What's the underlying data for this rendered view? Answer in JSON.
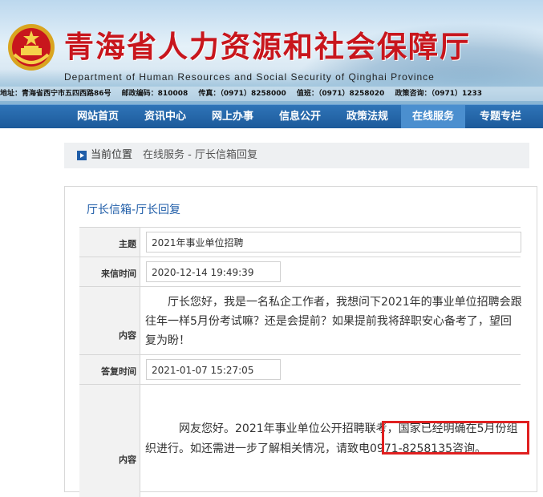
{
  "header": {
    "title": "青海省人力资源和社会保障厅",
    "subtitle": "Department of Human Resources and Social Security of Qinghai Province",
    "info": [
      "地址：青海省西宁市五四西路86号",
      "邮政编码：810008",
      "传真：（0971）8258000",
      "值班：（0971）8258020",
      "政策咨询：（0971）1233"
    ]
  },
  "nav": {
    "items": [
      "网站首页",
      "资讯中心",
      "网上办事",
      "信息公开",
      "政策法规",
      "在线服务",
      "专题专栏"
    ],
    "active_index": 5
  },
  "breadcrumb": {
    "label": "当前位置",
    "path": "在线服务 - 厅长信箱回复"
  },
  "panel": {
    "title": "厅长信箱-厅长回复",
    "subject_label": "主题",
    "subject_value": "2021年事业单位招聘",
    "sent_label": "来信时间",
    "sent_value": "2020-12-14 19:49:39",
    "content_label": "内容",
    "content_value": "厅长您好，我是一名私企工作者，我想问下2021年的事业单位招聘会跟往年一样5月份考试嘛？还是会提前？如果提前我将辞职安心备考了，望回复为盼！",
    "reply_time_label": "答复时间",
    "reply_time_value": "2021-01-07 15:27:05",
    "reply_label": "内容",
    "reply_value": "网友您好。2021年事业单位公开招聘联考，国家已经明确在5月份组织进行。如还需进一步了解相关情况，请致电0971-8258135咨询。"
  },
  "colors": {
    "title_red": "#c8161d",
    "nav_blue": "#1c5a9a",
    "link_blue": "#1f5da8",
    "highlight_red": "#e02020"
  }
}
